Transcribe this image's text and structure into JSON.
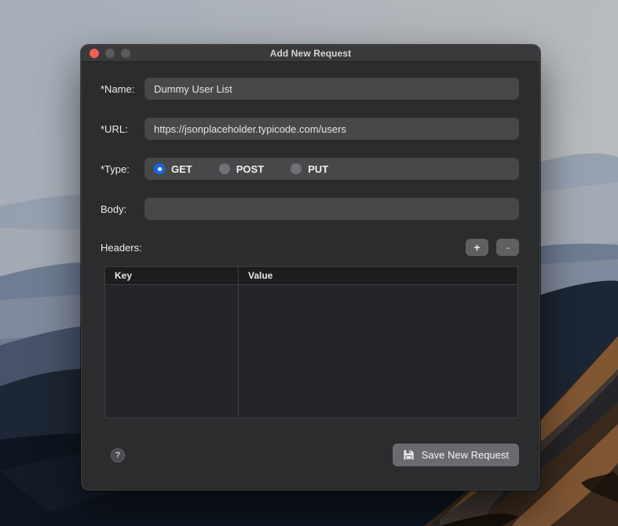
{
  "window": {
    "title": "Add New Request",
    "traffic_lights": {
      "close": "close",
      "minimize": "minimize",
      "zoom": "zoom"
    }
  },
  "form": {
    "name": {
      "label": "*Name:",
      "value": "Dummy User List"
    },
    "url": {
      "label": "*URL:",
      "value": "https://jsonplaceholder.typicode.com/users"
    },
    "type": {
      "label": "*Type:",
      "options": [
        {
          "label": "GET",
          "selected": true
        },
        {
          "label": "POST",
          "selected": false
        },
        {
          "label": "PUT",
          "selected": false
        }
      ]
    },
    "body": {
      "label": "Body:",
      "value": ""
    },
    "headers": {
      "label": "Headers:",
      "add_button": "+",
      "remove_button": "-",
      "table": {
        "columns": [
          "Key",
          "Value"
        ],
        "rows": []
      }
    }
  },
  "footer": {
    "help_button": "?",
    "save_button": "Save New Request"
  },
  "colors": {
    "accent_blue": "#1667e2",
    "traffic_red": "#f45f55",
    "window_bg": "#2b2c2e",
    "field_bg": "#47484a"
  }
}
